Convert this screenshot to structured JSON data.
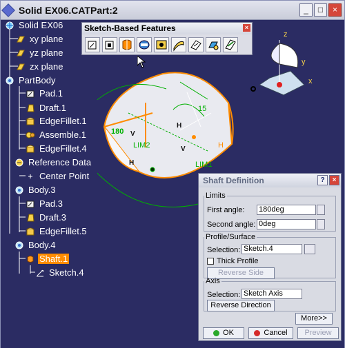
{
  "window": {
    "title": "Solid EX06.CATPart:2"
  },
  "tree": {
    "items": [
      {
        "label": "Solid EX06",
        "icon": "part-icon"
      },
      {
        "label": "xy plane",
        "icon": "plane-icon"
      },
      {
        "label": "yz plane",
        "icon": "plane-icon"
      },
      {
        "label": "zx plane",
        "icon": "plane-icon"
      },
      {
        "label": "PartBody",
        "icon": "body-icon"
      },
      {
        "label": "Pad.1",
        "icon": "pad-icon"
      },
      {
        "label": "Draft.1",
        "icon": "draft-icon"
      },
      {
        "label": "EdgeFillet.1",
        "icon": "edgefillet-icon"
      },
      {
        "label": "Assemble.1",
        "icon": "assemble-icon"
      },
      {
        "label": "EdgeFillet.4",
        "icon": "edgefillet-icon"
      },
      {
        "label": "Reference Data",
        "icon": "geometrical-set-icon"
      },
      {
        "label": "Center Point",
        "icon": "point-icon"
      },
      {
        "label": "Body.3",
        "icon": "body-icon"
      },
      {
        "label": "Pad.3",
        "icon": "pad-icon"
      },
      {
        "label": "Draft.3",
        "icon": "draft-icon"
      },
      {
        "label": "EdgeFillet.5",
        "icon": "edgefillet-icon"
      },
      {
        "label": "Body.4",
        "icon": "body-icon"
      },
      {
        "label": "Shaft.1",
        "icon": "shaft-icon"
      },
      {
        "label": "Sketch.4",
        "icon": "sketch-icon"
      }
    ]
  },
  "toolbar": {
    "title": "Sketch-Based Features",
    "tools": [
      "pad-icon",
      "pocket-icon",
      "shaft-icon",
      "groove-icon",
      "hole-icon",
      "rib-icon",
      "slot-icon",
      "multi-section-solid-icon",
      "stiffener-icon"
    ]
  },
  "viewport": {
    "labels": {
      "angle": "180",
      "dim": "15",
      "lim1": "LIM1",
      "lim2": "LIM2",
      "h1": "H",
      "h2": "H",
      "h3": "H",
      "v1": "V",
      "v2": "V"
    },
    "axes": {
      "x": "x",
      "y": "y",
      "z": "z"
    }
  },
  "dialog": {
    "title": "Shaft Definition",
    "help": "?",
    "limits": {
      "legend": "Limits",
      "first_angle_label": "First angle:",
      "first_angle_value": "180deg",
      "second_angle_label": "Second angle:",
      "second_angle_value": "0deg"
    },
    "profile": {
      "legend": "Profile/Surface",
      "selection_label": "Selection:",
      "selection_value": "Sketch.4",
      "thick_profile_label": "Thick Profile",
      "thick_profile_checked": false,
      "reverse_side_label": "Reverse Side"
    },
    "axis": {
      "legend": "Axis",
      "selection_label": "Selection:",
      "selection_value": "Sketch Axis",
      "reverse_direction_label": "Reverse Direction"
    },
    "more_label": "More>>",
    "ok_label": "OK",
    "cancel_label": "Cancel",
    "preview_label": "Preview"
  },
  "colors": {
    "background": "#2b2c63",
    "highlight": "#ff8c00",
    "geometry_edges": "#ff8c00",
    "constraints": "#00b000"
  }
}
